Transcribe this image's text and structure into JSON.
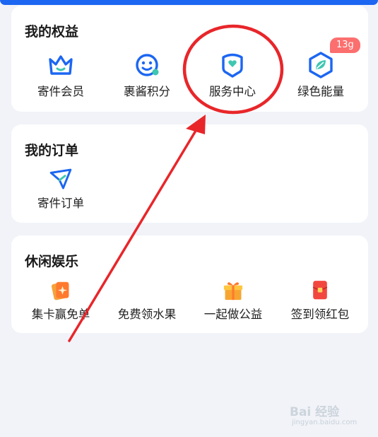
{
  "rights": {
    "title": "我的权益",
    "badge": "13g",
    "items": [
      {
        "label": "寄件会员",
        "icon": "crown-icon"
      },
      {
        "label": "裹酱积分",
        "icon": "smiley-icon"
      },
      {
        "label": "服务中心",
        "icon": "service-heart-icon"
      },
      {
        "label": "绿色能量",
        "icon": "leaf-hexagon-icon"
      }
    ]
  },
  "orders": {
    "title": "我的订单",
    "items": [
      {
        "label": "寄件订单",
        "icon": "paper-plane-icon"
      }
    ]
  },
  "leisure": {
    "title": "休闲娱乐",
    "items": [
      {
        "label": "集卡赢免单",
        "icon": "card-collect-icon"
      },
      {
        "label": "免费领水果",
        "icon": "fruit-icon"
      },
      {
        "label": "一起做公益",
        "icon": "gift-box-icon"
      },
      {
        "label": "签到领红包",
        "icon": "red-envelope-icon"
      }
    ]
  },
  "colors": {
    "accent": "#1c66f2",
    "badge": "#fb6f6e",
    "annotation": "#e8262a"
  },
  "watermark": {
    "main": "Bai 经验",
    "sub": "jingyan.baidu.com"
  }
}
